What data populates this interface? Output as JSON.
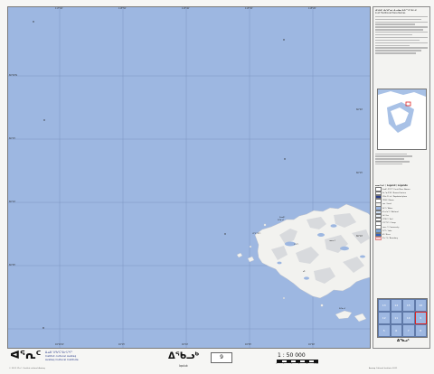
{
  "map": {
    "top_ticks": [
      "117°00'",
      "115°50'",
      "115°40'",
      "115°30'",
      "115°20'"
    ],
    "bottom_ticks": [
      "94°20'W",
      "94°15'",
      "94°10'",
      "94°05'",
      "94°00'"
    ],
    "left_ticks": [
      "66°20'N",
      "66°15'",
      "66°10'",
      "66°05'"
    ],
    "right_ticks": [
      "66°20'",
      "66°15'",
      "66°10'"
    ],
    "colors": {
      "water": "#9db7e1",
      "land": "#f2f2ef",
      "grid": "#5f79a8",
      "frame": "#7a7a7a"
    }
  },
  "panel": {
    "title_syll": "ᐊᕐᕕᐊᑦ ᐊᓯᐊᓐᓂᒃ ᐃᓗᐊᓂ ᐅᐱᓐᖏᕐᕕᖕᒧᑦ",
    "title_en": "Inuit Traditional Place Names",
    "legend_title": "ᓇᓂᓯᒪᔪᑦ / Legend / Légende",
    "legend": [
      "ᐃᓄᐃᑦ ᐊᑎᖏᑦ / Inuit Place Names",
      "ᐃᓕᓐᓂᐊᕐᕕᒃ / Named feature",
      "ᐊᑦᔨᓕᐅᕐᓗᒍ / Populated place",
      "ᑐᕌᕐᕕᒃ / Route",
      "ᓄᓇ / Land",
      "ᐃᒪᖅ / Water",
      "ᑲᓐᓂᕐᓂᖅ / Wetland",
      "ᓯᑯ / Ice",
      "ᐊᕐᕋᐅᑦ / Trail",
      "ᐊᖏᕐᕋᖅ / Camp",
      "ᓄᓇᓕᒃ / Community",
      "ᑕᓯᖅ / Lake",
      "ᑰᒃ / River",
      "ᑭᒡᓕᖓ / Boundary"
    ],
    "index_grid": [
      "13",
      "14",
      "15",
      "16",
      "12",
      "11",
      "10",
      "9",
      "5",
      "6",
      "7",
      "8"
    ],
    "index_highlight": "9",
    "sheet_label_syll": "ᐃᖃᓗᒃ"
  },
  "footer": {
    "logo_syll": "ᐊᕐᕆᑦ",
    "logo_lines": [
      "ᐃᓄᐃᑦ ᐱᖃᑦᑕᕐᕕᓕᒫᖏᑦ",
      "Institut culturel Avataq",
      "Avataq Cultural Institute"
    ],
    "title_syll": "ᐃᖃᓗᒃ",
    "title_latin": "Iqaluk",
    "sheet_number": "9",
    "scale": "1 : 50 000",
    "scale_units": [
      "0",
      "1",
      "2",
      "3",
      "4",
      "5 km"
    ],
    "small_left": "© 2011 ᐊᕐᕆᑦ / Institut culturel Avataq",
    "small_right": "Avataq Cultural Institute 2011"
  }
}
